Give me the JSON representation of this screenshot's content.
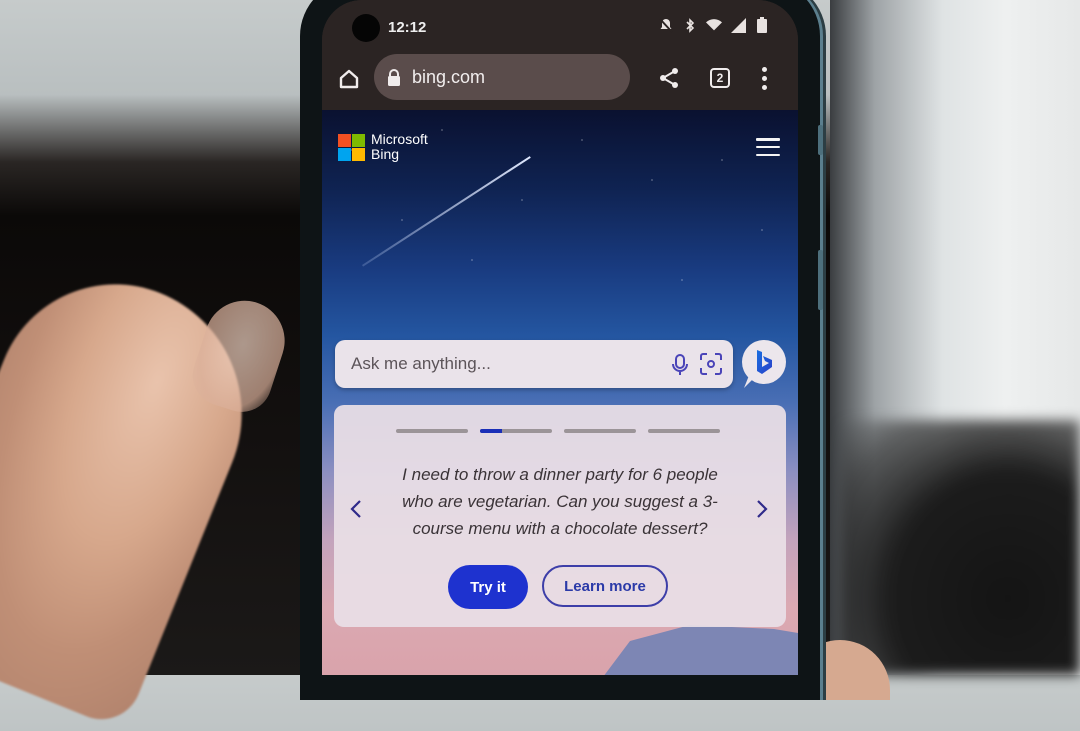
{
  "status_bar": {
    "time": "12:12",
    "icons": [
      "notifications-muted-icon",
      "bluetooth-icon",
      "wifi-icon",
      "cell-signal-icon",
      "battery-icon"
    ]
  },
  "browser": {
    "url": "bing.com",
    "tab_count": "2",
    "icons": {
      "home": "home-icon",
      "lock": "lock-icon",
      "share": "share-icon",
      "menu": "more-vert-icon"
    }
  },
  "page": {
    "logo": {
      "line1": "Microsoft",
      "line2": "Bing",
      "colors": [
        "#f25022",
        "#7fba00",
        "#00a4ef",
        "#ffb900"
      ]
    },
    "search": {
      "placeholder": "Ask me anything...",
      "value": ""
    },
    "carousel": {
      "total_slides": 4,
      "active_slide": 2,
      "active_progress": 0.3,
      "prompt": "I need to throw a dinner party for 6 people who are vegetarian. Can you suggest a 3-course menu with a chocolate dessert?",
      "primary_button": "Try it",
      "secondary_button": "Learn more"
    },
    "accent_color": "#1e32cf"
  }
}
